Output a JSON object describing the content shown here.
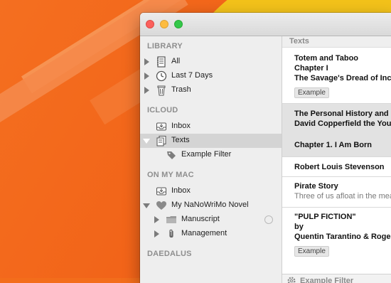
{
  "sidebar": {
    "library_header": "LIBRARY",
    "library_items": [
      {
        "label": "All"
      },
      {
        "label": "Last 7 Days"
      },
      {
        "label": "Trash"
      }
    ],
    "icloud_header": "ICLOUD",
    "icloud_items": [
      {
        "label": "Inbox"
      },
      {
        "label": "Texts"
      },
      {
        "label": "Example Filter"
      }
    ],
    "mac_header": "ON MY MAC",
    "mac_items": [
      {
        "label": "Inbox"
      },
      {
        "label": "My NaNoWriMo Novel"
      },
      {
        "label": "Manuscript"
      },
      {
        "label": "Management"
      }
    ],
    "daedalus_header": "DAEDALUS"
  },
  "list": {
    "header": "Texts",
    "cards": [
      {
        "lines": [
          "Totem and Taboo",
          "Chapter I",
          "The Savage's Dread of Incest"
        ],
        "tag": "Example"
      },
      {
        "lines": [
          "The Personal History and Experience of",
          "David Copperfield the Younger",
          "Chapter 1. I Am Born"
        ]
      },
      {
        "lines": [
          "Robert Louis Stevenson"
        ]
      },
      {
        "lines": [
          "Pirate Story"
        ],
        "excerpt": "Three of us afloat in the meadow by the swing"
      },
      {
        "lines": [
          "\"PULP FICTION\"",
          "by",
          "Quentin Tarantino & Roger Avary"
        ],
        "tag": "Example"
      }
    ],
    "footer_filter": "Example Filter"
  },
  "colors": {
    "close": "#fc605c",
    "minimize": "#fdbc40",
    "maximize": "#34c84a",
    "selection": "#d4d4d4"
  }
}
